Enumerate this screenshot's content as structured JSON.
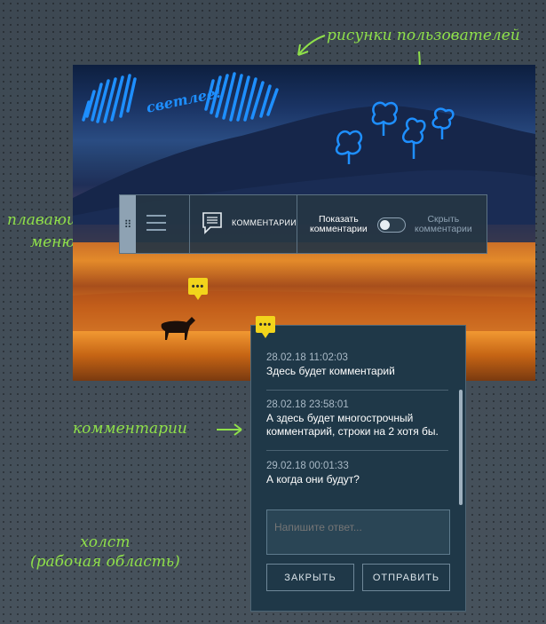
{
  "annotations": {
    "user_drawings": "рисунки пользователей",
    "floating_menu_line1": "плавающее",
    "floating_menu_line2": "меню",
    "comments": "комментарии",
    "canvas_line1": "холст",
    "canvas_line2": "(рабочая область)"
  },
  "drawing": {
    "scribble_text": "светлее!"
  },
  "menu": {
    "comments_label": "КОММЕНТАРИИ",
    "show_label_line1": "Показать",
    "show_label_line2": "комментарии",
    "hide_label_line1": "Скрыть",
    "hide_label_line2": "комментарии",
    "toggle_state": "off"
  },
  "comments": [
    {
      "timestamp": "28.02.18 11:02:03",
      "text": "Здесь будет комментарий"
    },
    {
      "timestamp": "28.02.18 23:58:01",
      "text_line1": "А здесь будет многострочный",
      "text_line2": "комментарий, строки на 2 хотя бы."
    },
    {
      "timestamp": "29.02.18 00:01:33",
      "text": "А когда они будут?"
    }
  ],
  "reply": {
    "placeholder": "Напишите ответ..."
  },
  "buttons": {
    "close": "ЗАКРЫТЬ",
    "send": "ОТПРАВИТЬ"
  },
  "marker_glyph": "•••",
  "colors": {
    "accent": "#8fe04a",
    "marker": "#f2d41b",
    "drawing": "#1e8fff",
    "panel": "#1f3848"
  }
}
